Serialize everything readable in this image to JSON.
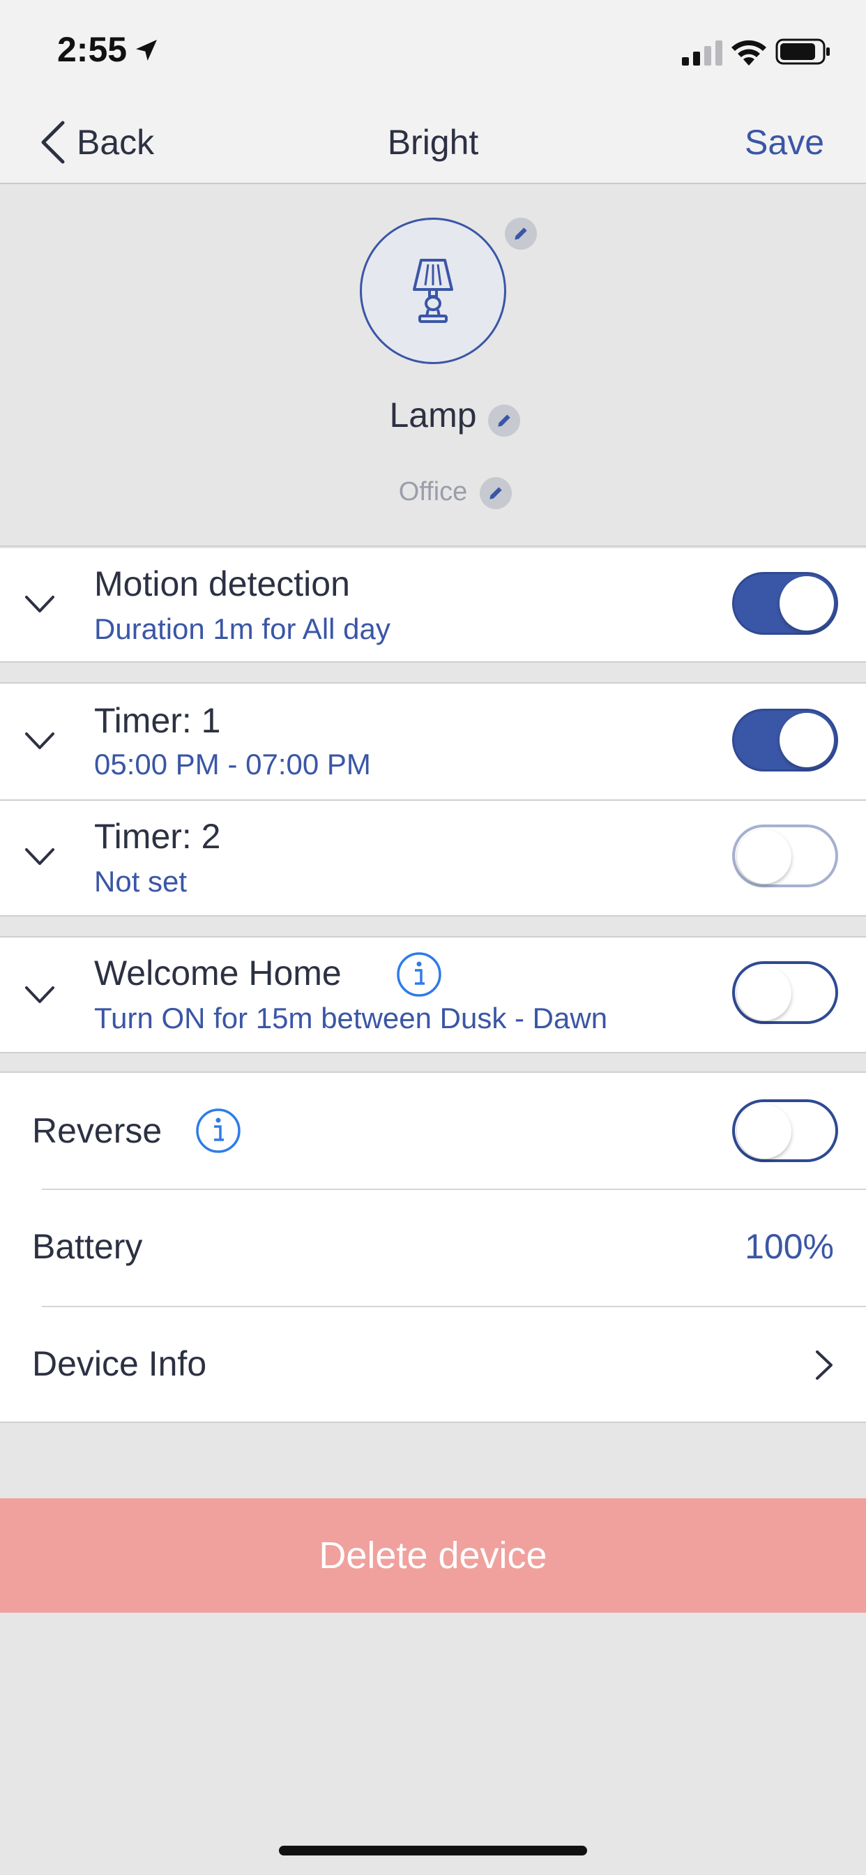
{
  "status_bar": {
    "time": "2:55",
    "icons": [
      "location-arrow-icon",
      "signal-icon",
      "wifi-icon",
      "battery-icon"
    ]
  },
  "nav": {
    "back_label": "Back",
    "title": "Bright",
    "save_label": "Save"
  },
  "device": {
    "icon": "lamp-icon",
    "name": "Lamp",
    "room": "Office"
  },
  "schedules": [
    {
      "title": "Motion detection",
      "subtitle": "Duration 1m for All day",
      "enabled": true
    },
    {
      "title": "Timer: 1",
      "subtitle": "05:00 PM - 07:00 PM",
      "enabled": true
    },
    {
      "title": "Timer: 2",
      "subtitle": "Not set",
      "enabled": false
    },
    {
      "title": "Welcome Home",
      "subtitle": "Turn ON for 15m between Dusk - Dawn",
      "enabled": false
    }
  ],
  "settings": {
    "reverse_label": "Reverse",
    "reverse_enabled": false,
    "battery_label": "Battery",
    "battery_value": "100%",
    "device_info_label": "Device Info"
  },
  "delete_label": "Delete device",
  "colors": {
    "accent": "#3a56a6",
    "delete": "#f0a19d",
    "background": "#e6e6e6"
  }
}
